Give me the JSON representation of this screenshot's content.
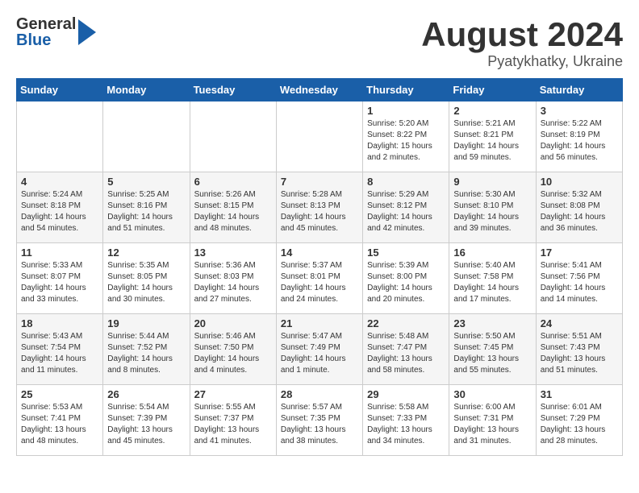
{
  "header": {
    "logo": {
      "line1": "General",
      "line2": "Blue"
    },
    "title": "August 2024",
    "location": "Pyatykhatky, Ukraine"
  },
  "days_of_week": [
    "Sunday",
    "Monday",
    "Tuesday",
    "Wednesday",
    "Thursday",
    "Friday",
    "Saturday"
  ],
  "weeks": [
    [
      {
        "day": "",
        "info": ""
      },
      {
        "day": "",
        "info": ""
      },
      {
        "day": "",
        "info": ""
      },
      {
        "day": "",
        "info": ""
      },
      {
        "day": "1",
        "info": "Sunrise: 5:20 AM\nSunset: 8:22 PM\nDaylight: 15 hours\nand 2 minutes."
      },
      {
        "day": "2",
        "info": "Sunrise: 5:21 AM\nSunset: 8:21 PM\nDaylight: 14 hours\nand 59 minutes."
      },
      {
        "day": "3",
        "info": "Sunrise: 5:22 AM\nSunset: 8:19 PM\nDaylight: 14 hours\nand 56 minutes."
      }
    ],
    [
      {
        "day": "4",
        "info": "Sunrise: 5:24 AM\nSunset: 8:18 PM\nDaylight: 14 hours\nand 54 minutes."
      },
      {
        "day": "5",
        "info": "Sunrise: 5:25 AM\nSunset: 8:16 PM\nDaylight: 14 hours\nand 51 minutes."
      },
      {
        "day": "6",
        "info": "Sunrise: 5:26 AM\nSunset: 8:15 PM\nDaylight: 14 hours\nand 48 minutes."
      },
      {
        "day": "7",
        "info": "Sunrise: 5:28 AM\nSunset: 8:13 PM\nDaylight: 14 hours\nand 45 minutes."
      },
      {
        "day": "8",
        "info": "Sunrise: 5:29 AM\nSunset: 8:12 PM\nDaylight: 14 hours\nand 42 minutes."
      },
      {
        "day": "9",
        "info": "Sunrise: 5:30 AM\nSunset: 8:10 PM\nDaylight: 14 hours\nand 39 minutes."
      },
      {
        "day": "10",
        "info": "Sunrise: 5:32 AM\nSunset: 8:08 PM\nDaylight: 14 hours\nand 36 minutes."
      }
    ],
    [
      {
        "day": "11",
        "info": "Sunrise: 5:33 AM\nSunset: 8:07 PM\nDaylight: 14 hours\nand 33 minutes."
      },
      {
        "day": "12",
        "info": "Sunrise: 5:35 AM\nSunset: 8:05 PM\nDaylight: 14 hours\nand 30 minutes."
      },
      {
        "day": "13",
        "info": "Sunrise: 5:36 AM\nSunset: 8:03 PM\nDaylight: 14 hours\nand 27 minutes."
      },
      {
        "day": "14",
        "info": "Sunrise: 5:37 AM\nSunset: 8:01 PM\nDaylight: 14 hours\nand 24 minutes."
      },
      {
        "day": "15",
        "info": "Sunrise: 5:39 AM\nSunset: 8:00 PM\nDaylight: 14 hours\nand 20 minutes."
      },
      {
        "day": "16",
        "info": "Sunrise: 5:40 AM\nSunset: 7:58 PM\nDaylight: 14 hours\nand 17 minutes."
      },
      {
        "day": "17",
        "info": "Sunrise: 5:41 AM\nSunset: 7:56 PM\nDaylight: 14 hours\nand 14 minutes."
      }
    ],
    [
      {
        "day": "18",
        "info": "Sunrise: 5:43 AM\nSunset: 7:54 PM\nDaylight: 14 hours\nand 11 minutes."
      },
      {
        "day": "19",
        "info": "Sunrise: 5:44 AM\nSunset: 7:52 PM\nDaylight: 14 hours\nand 8 minutes."
      },
      {
        "day": "20",
        "info": "Sunrise: 5:46 AM\nSunset: 7:50 PM\nDaylight: 14 hours\nand 4 minutes."
      },
      {
        "day": "21",
        "info": "Sunrise: 5:47 AM\nSunset: 7:49 PM\nDaylight: 14 hours\nand 1 minute."
      },
      {
        "day": "22",
        "info": "Sunrise: 5:48 AM\nSunset: 7:47 PM\nDaylight: 13 hours\nand 58 minutes."
      },
      {
        "day": "23",
        "info": "Sunrise: 5:50 AM\nSunset: 7:45 PM\nDaylight: 13 hours\nand 55 minutes."
      },
      {
        "day": "24",
        "info": "Sunrise: 5:51 AM\nSunset: 7:43 PM\nDaylight: 13 hours\nand 51 minutes."
      }
    ],
    [
      {
        "day": "25",
        "info": "Sunrise: 5:53 AM\nSunset: 7:41 PM\nDaylight: 13 hours\nand 48 minutes."
      },
      {
        "day": "26",
        "info": "Sunrise: 5:54 AM\nSunset: 7:39 PM\nDaylight: 13 hours\nand 45 minutes."
      },
      {
        "day": "27",
        "info": "Sunrise: 5:55 AM\nSunset: 7:37 PM\nDaylight: 13 hours\nand 41 minutes."
      },
      {
        "day": "28",
        "info": "Sunrise: 5:57 AM\nSunset: 7:35 PM\nDaylight: 13 hours\nand 38 minutes."
      },
      {
        "day": "29",
        "info": "Sunrise: 5:58 AM\nSunset: 7:33 PM\nDaylight: 13 hours\nand 34 minutes."
      },
      {
        "day": "30",
        "info": "Sunrise: 6:00 AM\nSunset: 7:31 PM\nDaylight: 13 hours\nand 31 minutes."
      },
      {
        "day": "31",
        "info": "Sunrise: 6:01 AM\nSunset: 7:29 PM\nDaylight: 13 hours\nand 28 minutes."
      }
    ]
  ]
}
